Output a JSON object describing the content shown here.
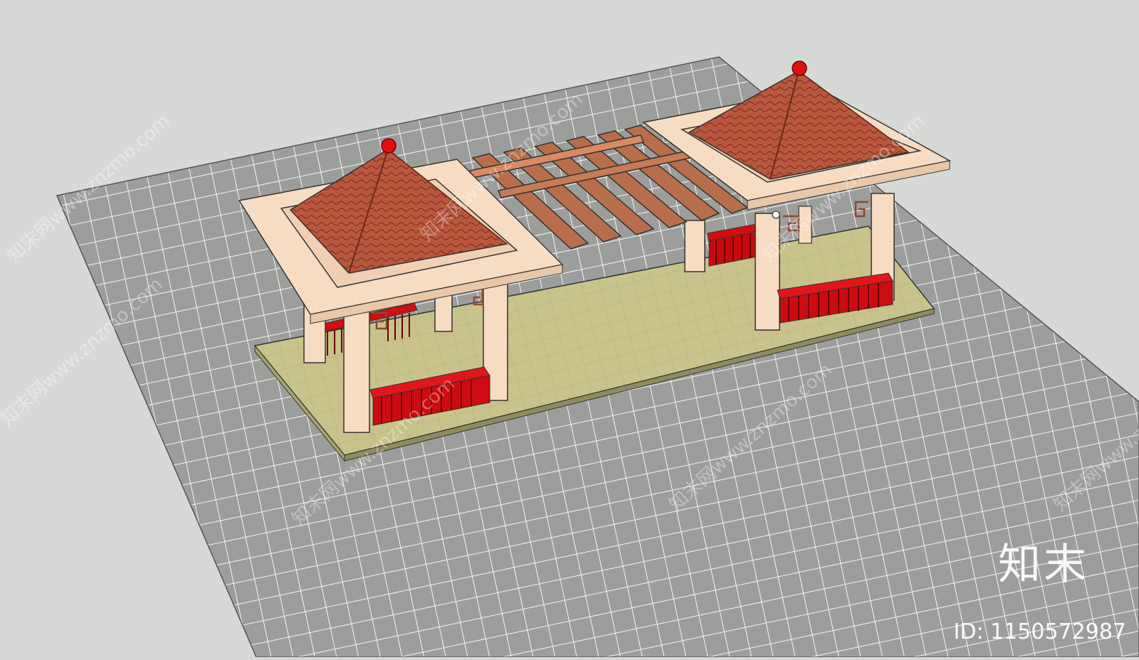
{
  "scene": {
    "subject": "sketchup-render-of-two-pavilions-joined-by-pergola",
    "colors": {
      "background": "#d7d9d7",
      "paving": "#9a9c9a",
      "paving_lines": "#f2f2f2",
      "platform": "#c9c48a",
      "column": "#f6dcc3",
      "roof_tile": "#b8553a",
      "beam": "#b86e4a",
      "bench": "#d40d10",
      "finial": "#e01010"
    }
  },
  "watermarks": {
    "brand_text": "知末",
    "id_text": "ID: 1150572987",
    "repeat_text": "知末网www.znzmo.com"
  }
}
